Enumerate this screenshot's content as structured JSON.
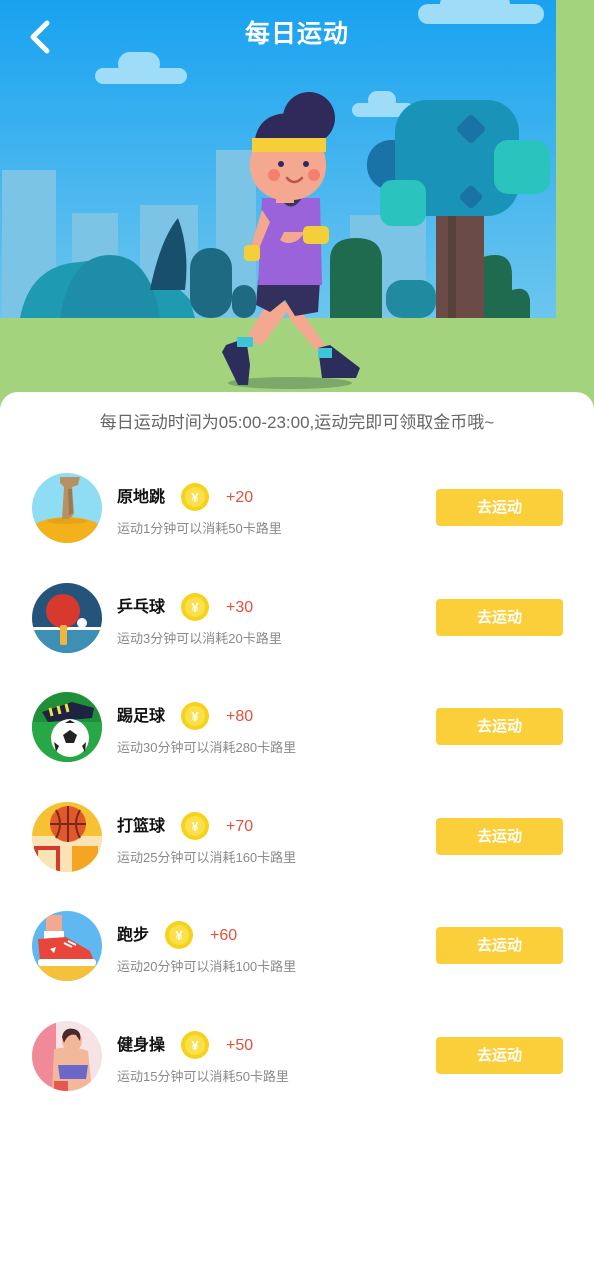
{
  "header": {
    "title": "每日运动",
    "back_icon": "chevron-left-icon"
  },
  "colors": {
    "sky": "#1fa8f0",
    "grass": "#a4d37e",
    "button": "#fbcf3a",
    "reward": "#e4513c",
    "coin": "#f7d21a"
  },
  "notice": "每日运动时间为05:00-23:00,运动完即可领取金币哦~",
  "exercises": [
    {
      "name": "原地跳",
      "reward": "+20",
      "desc": "运动1分钟可以消耗50卡路里",
      "button": "去运动",
      "icon": "jump-rope-icon"
    },
    {
      "name": "乒乓球",
      "reward": "+30",
      "desc": "运动3分钟可以消耗20卡路里",
      "button": "去运动",
      "icon": "ping-pong-icon"
    },
    {
      "name": "踢足球",
      "reward": "+80",
      "desc": "运动30分钟可以消耗280卡路里",
      "button": "去运动",
      "icon": "soccer-icon"
    },
    {
      "name": "打篮球",
      "reward": "+70",
      "desc": "运动25分钟可以消耗160卡路里",
      "button": "去运动",
      "icon": "basketball-icon"
    },
    {
      "name": "跑步",
      "reward": "+60",
      "desc": "运动20分钟可以消耗100卡路里",
      "button": "去运动",
      "icon": "running-shoe-icon"
    },
    {
      "name": "健身操",
      "reward": "+50",
      "desc": "运动15分钟可以消耗50卡路里",
      "button": "去运动",
      "icon": "aerobics-icon"
    }
  ],
  "coin_symbol": "¥"
}
